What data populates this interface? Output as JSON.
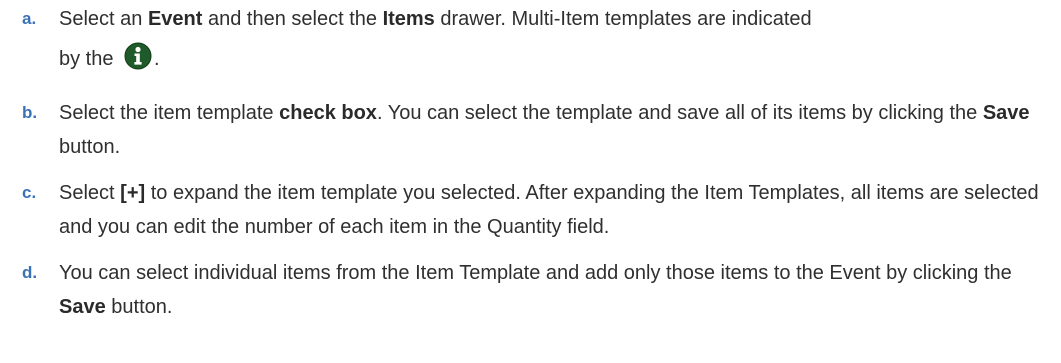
{
  "steps": [
    {
      "marker": "a.",
      "line1_pre": "Select an ",
      "line1_b1": "Event",
      "line1_mid": " and then select the ",
      "line1_b2": "Items",
      "line1_post": " drawer. Multi-Item templates are indicated",
      "line2_pre": "by the ",
      "line2_post": ".",
      "icon": "info-icon",
      "icon_color": "#1e5a2a"
    },
    {
      "marker": "b.",
      "pre": "Select the item template ",
      "b1": "check box",
      "mid": ". You can select the template and save all of its items by clicking the ",
      "b2": "Save",
      "post": " button."
    },
    {
      "marker": "c.",
      "pre": "Select ",
      "b1": "[+]",
      "post": " to expand the item template you selected. After expanding the Item Templates, all items are selected and you can edit the number of each item in the Quantity field."
    },
    {
      "marker": "d.",
      "pre": "You can select individual items from the Item Template and add only those items to the Event by clicking the ",
      "b1": "Save",
      "post": " button."
    }
  ],
  "colors": {
    "marker": "#3a72b8",
    "text": "#2f2f2f"
  }
}
